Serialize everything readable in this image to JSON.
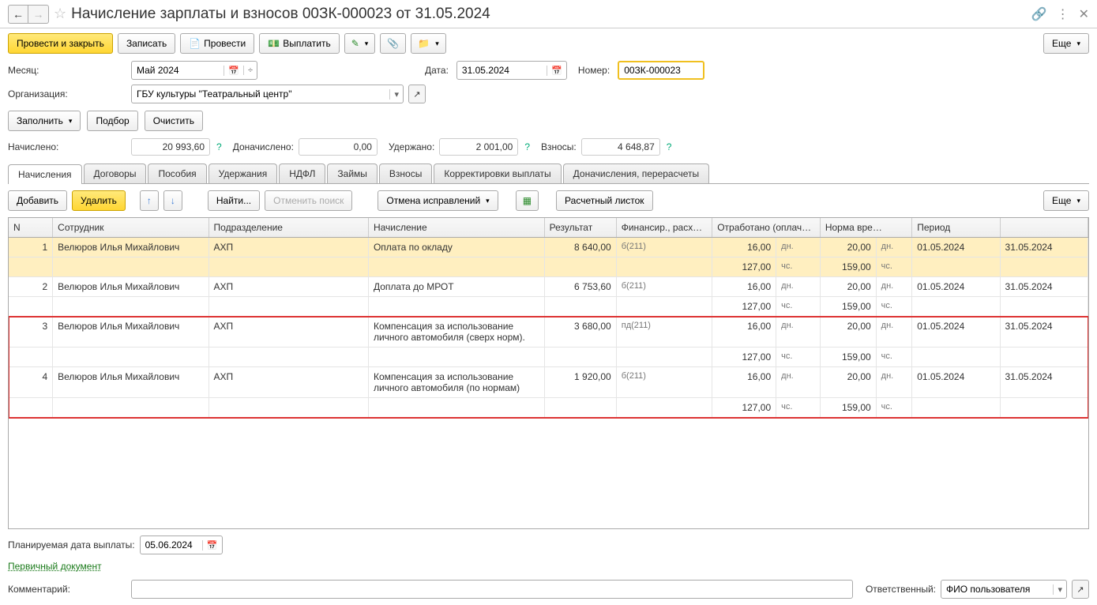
{
  "header": {
    "title": "Начисление зарплаты и взносов 00ЗК-000023 от 31.05.2024"
  },
  "toolbar": {
    "post_close": "Провести и закрыть",
    "save": "Записать",
    "post": "Провести",
    "pay": "Выплатить",
    "more": "Еще"
  },
  "fields": {
    "month_label": "Месяц:",
    "month_value": "Май 2024",
    "date_label": "Дата:",
    "date_value": "31.05.2024",
    "number_label": "Номер:",
    "number_value": "00ЗК-000023",
    "org_label": "Организация:",
    "org_value": "ГБУ культуры \"Театральный центр\"",
    "fill": "Заполнить",
    "select": "Подбор",
    "clear": "Очистить"
  },
  "summary": {
    "accrued_label": "Начислено:",
    "accrued": "20 993,60",
    "addl_label": "Доначислено:",
    "addl": "0,00",
    "withheld_label": "Удержано:",
    "withheld": "2 001,00",
    "contrib_label": "Взносы:",
    "contrib": "4 648,87"
  },
  "tabs": [
    "Начисления",
    "Договоры",
    "Пособия",
    "Удержания",
    "НДФЛ",
    "Займы",
    "Взносы",
    "Корректировки выплаты",
    "Доначисления, перерасчеты"
  ],
  "subtoolbar": {
    "add": "Добавить",
    "delete": "Удалить",
    "find": "Найти...",
    "cancel_search": "Отменить поиск",
    "cancel_corr": "Отмена исправлений",
    "payslip": "Расчетный листок",
    "more": "Еще"
  },
  "grid": {
    "cols": [
      "N",
      "Сотрудник",
      "Подразделение",
      "Начисление",
      "Результат",
      "Финансир., расходы",
      "Отработано (оплаче…",
      "Норма вре…",
      "Период",
      ""
    ],
    "rows": [
      {
        "n": "1",
        "emp": "Велюров Илья Михайлович",
        "dep": "АХП",
        "acc": "Оплата по окладу",
        "res": "8 640,00",
        "fin": "б(211)",
        "wd": "16,00",
        "wu": "дн.",
        "nd": "20,00",
        "nu": "дн.",
        "p1": "01.05.2024",
        "p2": "31.05.2024",
        "wh": "127,00",
        "whu": "чс.",
        "nh": "159,00",
        "nhu": "чс."
      },
      {
        "n": "2",
        "emp": "Велюров Илья Михайлович",
        "dep": "АХП",
        "acc": "Доплата до МРОТ",
        "res": "6 753,60",
        "fin": "б(211)",
        "wd": "16,00",
        "wu": "дн.",
        "nd": "20,00",
        "nu": "дн.",
        "p1": "01.05.2024",
        "p2": "31.05.2024",
        "wh": "127,00",
        "whu": "чс.",
        "nh": "159,00",
        "nhu": "чс."
      },
      {
        "n": "3",
        "emp": "Велюров Илья Михайлович",
        "dep": "АХП",
        "acc": "Компенсация за использование личного автомобиля (сверх норм).",
        "res": "3 680,00",
        "fin": "пд(211)",
        "wd": "16,00",
        "wu": "дн.",
        "nd": "20,00",
        "nu": "дн.",
        "p1": "01.05.2024",
        "p2": "31.05.2024",
        "wh": "127,00",
        "whu": "чс.",
        "nh": "159,00",
        "nhu": "чс."
      },
      {
        "n": "4",
        "emp": "Велюров Илья Михайлович",
        "dep": "АХП",
        "acc": "Компенсация за использование личного автомобиля (по нормам)",
        "res": "1 920,00",
        "fin": "б(211)",
        "wd": "16,00",
        "wu": "дн.",
        "nd": "20,00",
        "nu": "дн.",
        "p1": "01.05.2024",
        "p2": "31.05.2024",
        "wh": "127,00",
        "whu": "чс.",
        "nh": "159,00",
        "nhu": "чс."
      }
    ]
  },
  "footer": {
    "paydate_label": "Планируемая дата выплаты:",
    "paydate": "05.06.2024",
    "primary_doc": "Первичный документ",
    "comment_label": "Комментарий:",
    "responsible_label": "Ответственный:",
    "responsible": "ФИО пользователя"
  }
}
